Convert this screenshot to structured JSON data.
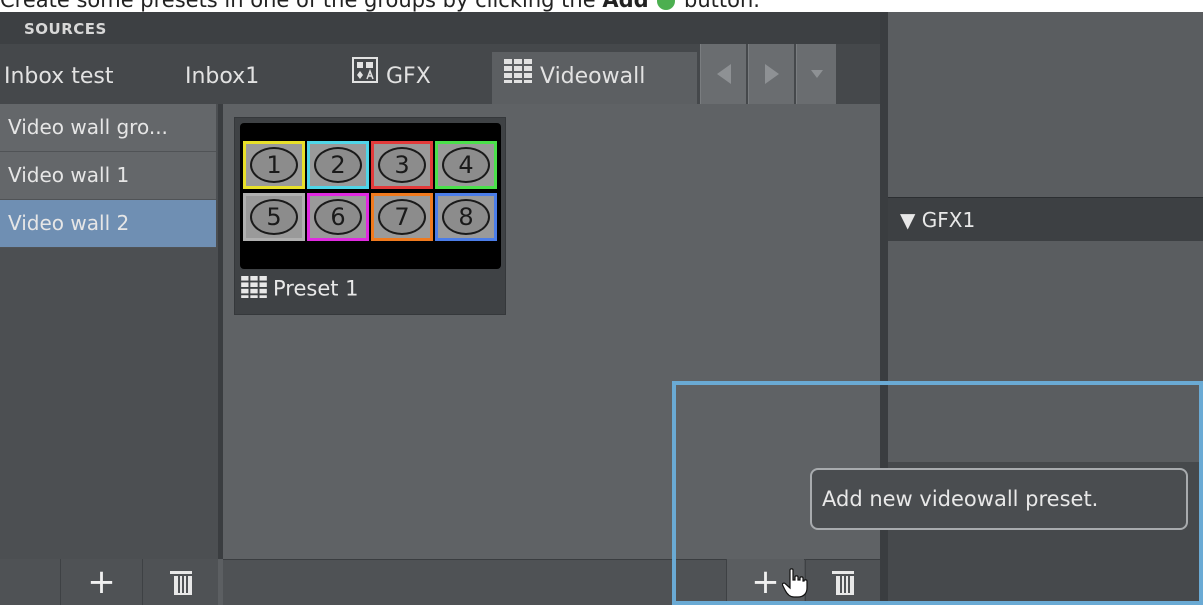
{
  "caption": {
    "text_before": "Create some presets in one of the groups by clicking the",
    "strong": "Add",
    "text_after": "button."
  },
  "sources": {
    "header": "SOURCES"
  },
  "tabs": [
    {
      "label": "Inbox test"
    },
    {
      "label": "Inbox1"
    },
    {
      "label": "GFX",
      "icon": "gfx-icon"
    },
    {
      "label": "Videowall",
      "icon": "videowall-icon",
      "active": true
    }
  ],
  "groups": [
    {
      "label": "Video wall gro..."
    },
    {
      "label": "Video wall 1"
    },
    {
      "label": "Video wall 2",
      "selected": true
    }
  ],
  "preset": {
    "label": "Preset 1",
    "cells": [
      {
        "num": "1",
        "color": "#e8e02a"
      },
      {
        "num": "2",
        "color": "#4fd6e8"
      },
      {
        "num": "3",
        "color": "#e23a3a"
      },
      {
        "num": "4",
        "color": "#4be04b"
      },
      {
        "num": "5",
        "color": "#b0b0b0"
      },
      {
        "num": "6",
        "color": "#e02ae0"
      },
      {
        "num": "7",
        "color": "#f07a1e"
      },
      {
        "num": "8",
        "color": "#4b7de8"
      }
    ]
  },
  "right_panel": {
    "gfx_header": "GFX1"
  },
  "toolbar": {
    "add_symbol": "+"
  },
  "tooltip": {
    "text": "Add new videowall preset."
  },
  "colors": {
    "selected": "#6f8fb3",
    "highlight": "#6aaad4",
    "add_green": "#4caf50"
  }
}
